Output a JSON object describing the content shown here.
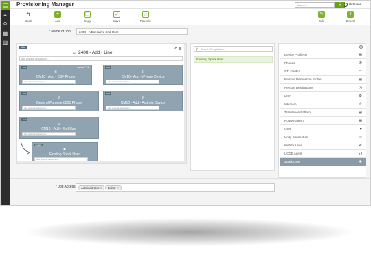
{
  "app": {
    "title": "Provisioning Manager"
  },
  "header": {
    "search_placeholder": "Search...",
    "user_label": "Hi Evans"
  },
  "toolbar": {
    "back_label": "Back",
    "add_label": "Add",
    "copy_label": "Copy",
    "save_label": "Save",
    "favorite_label": "Favorite",
    "edit_label": "Edit",
    "export_label": "Export"
  },
  "job": {
    "name_label": "* Name of Job",
    "name_value": "2408 - A Executive End User"
  },
  "workflow": {
    "title": "2408 - Add - Line",
    "add_tag": "Add",
    "description_placeholder": "add optional description...",
    "cards": [
      {
        "tag": "Add",
        "title": "CM10 - Add - CSF Phone",
        "placeholder": "add optional description...",
        "tools": "Actual"
      },
      {
        "tag": "Add",
        "title": "CM10 - Add - iPhone Device",
        "placeholder": "add optional description..."
      },
      {
        "tag": "Add",
        "title": "General Purpose 8851 Phone",
        "placeholder": "add optional description..."
      },
      {
        "tag": "Add",
        "title": "CM10 - Add - Android Device",
        "placeholder": "add optional description..."
      },
      {
        "tag": "Add",
        "title": "CM10 - Add - End User",
        "placeholder": "add optional description..."
      },
      {
        "tag": "Update",
        "title": "Existing Spark User",
        "placeholder": "add optional description..."
      }
    ]
  },
  "templates": {
    "search_placeholder": "Search Templates...",
    "items": [
      "Existing Spark User"
    ]
  },
  "right_list": {
    "items": [
      {
        "label": "Device Profile(s)",
        "icon": "document-icon",
        "glyph": "▤"
      },
      {
        "label": "Phones",
        "icon": "phone-icon",
        "glyph": "✆"
      },
      {
        "label": "CTI Routes",
        "icon": "route-icon",
        "glyph": "⤳"
      },
      {
        "label": "Remote Destination Profile",
        "icon": "document-icon",
        "glyph": "▤"
      },
      {
        "label": "Remote Destinations",
        "icon": "clock-icon",
        "glyph": "◷"
      },
      {
        "label": "Line",
        "icon": "gear-icon",
        "glyph": "⚙"
      },
      {
        "label": "Intercom",
        "icon": "star-icon",
        "glyph": "☆"
      },
      {
        "label": "Translation Pattern",
        "icon": "document-icon",
        "glyph": "▤"
      },
      {
        "label": "Route Pattern",
        "icon": "document-icon",
        "glyph": "▤"
      },
      {
        "label": "User",
        "icon": "user-icon",
        "glyph": "●"
      },
      {
        "label": "Unity Connection",
        "icon": "voicemail-icon",
        "glyph": "∞"
      },
      {
        "label": "WebEx User",
        "icon": "share-icon",
        "glyph": "⋖"
      },
      {
        "label": "UCCE Agent",
        "icon": "headset-icon",
        "glyph": "☊"
      },
      {
        "label": "Spark User",
        "icon": "spark-icon",
        "glyph": "✹"
      }
    ],
    "selected_index": 13
  },
  "access": {
    "label": "* Job Access",
    "chips": [
      "Administrator",
      "Editor"
    ]
  },
  "colors": {
    "brand_green": "#6a9f1c",
    "card": "#8fa3b0",
    "rail": "#2d2d2d",
    "selected": "#8a9aa6"
  }
}
